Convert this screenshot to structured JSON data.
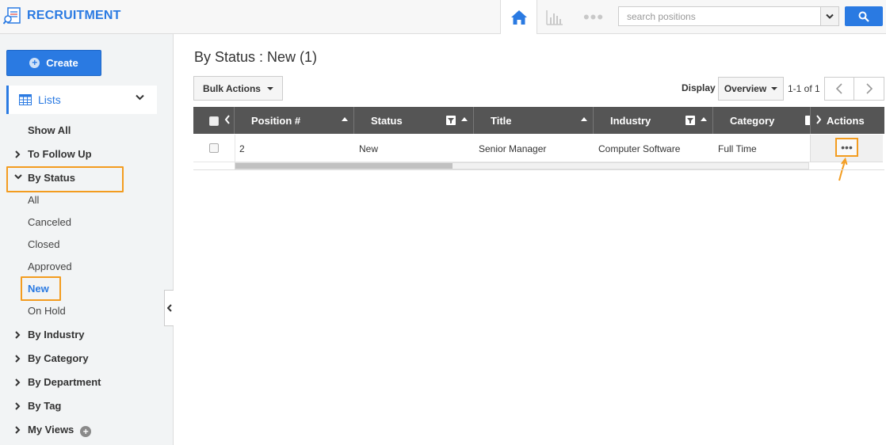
{
  "app": {
    "title": "RECRUITMENT"
  },
  "topnav": {
    "home_icon": "home-icon",
    "chart_icon": "bar-chart-icon",
    "more_icon": "more-dots-icon",
    "more_glyph": "•••",
    "search_placeholder": "search positions"
  },
  "sidebar": {
    "create_label": "Create",
    "lists_label": "Lists",
    "items": [
      {
        "label": "Show All"
      },
      {
        "label": "To Follow Up"
      },
      {
        "label": "By Status"
      },
      {
        "label": "All"
      },
      {
        "label": "Canceled"
      },
      {
        "label": "Closed"
      },
      {
        "label": "Approved"
      },
      {
        "label": "New"
      },
      {
        "label": "On Hold"
      },
      {
        "label": "By Industry"
      },
      {
        "label": "By Category"
      },
      {
        "label": "By Department"
      },
      {
        "label": "By Tag"
      },
      {
        "label": "My Views"
      }
    ]
  },
  "main": {
    "title": "By Status : New (1)",
    "bulk_actions_label": "Bulk Actions",
    "display_label": "Display",
    "display_value": "Overview",
    "page_count": "1-1 of 1"
  },
  "table": {
    "columns": [
      "Position #",
      "Status",
      "Title",
      "Industry",
      "Category",
      "Actions"
    ],
    "rows": [
      [
        "2",
        "New",
        "Senior Manager",
        "Computer Software",
        "Full Time"
      ]
    ],
    "actions_glyph": "•••"
  },
  "colors": {
    "accent": "#2a7ae2",
    "highlight": "#f39c1f",
    "header_bg": "#555555"
  }
}
